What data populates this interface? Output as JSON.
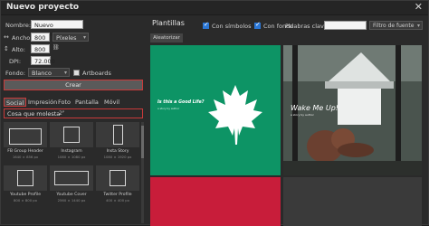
{
  "dialog": {
    "title": "Nuevo proyecto",
    "close_glyph": "✕"
  },
  "form": {
    "name_label": "Nombre:",
    "name_value": "Nuevo proyecto",
    "width_label": "Ancho:",
    "width_value": "800",
    "units_value": "Píxeles",
    "height_label": "Alto:",
    "height_value": "800",
    "dpi_label": "DPI:",
    "dpi_value": "72.000",
    "background_label": "Fondo:",
    "background_value": "Blanco",
    "artboards_label": "Artboards",
    "create_label": "Crear"
  },
  "tabs": [
    "Social",
    "Impresión",
    "Foto",
    "Pantalla",
    "Móvil"
  ],
  "search": {
    "value": "Cosa que molesta",
    "caret": "2ᴾ"
  },
  "presets": [
    {
      "name": "FB Group Header",
      "size": "1640 × 856 px"
    },
    {
      "name": "Instagram",
      "size": "1080 × 1080 px"
    },
    {
      "name": "Insta Story",
      "size": "1080 × 1920 px"
    },
    {
      "name": "Youtube Profile",
      "size": "800 × 800 px"
    },
    {
      "name": "Youtube Cover",
      "size": "2560 × 1440 px"
    },
    {
      "name": "Twitter Profile",
      "size": "400 × 400 px"
    }
  ],
  "templates_panel": {
    "title": "Plantillas",
    "with_symbols_label": "Con símbolos",
    "with_background_label": "Con fondo",
    "keywords_label": "Palabras clave:",
    "filter_label": "Filtro de fuente",
    "shuffle_label": "Aleatorizar",
    "cards": [
      {
        "headline": "Is this a Good Life?",
        "subline": "a story by author"
      },
      {
        "headline": "Wake Me Up!",
        "subline": "a story by author"
      }
    ]
  },
  "colors": {
    "green_card": "#0d9465",
    "red_card": "#c81d3a",
    "accent_outline": "#c93a3a"
  }
}
